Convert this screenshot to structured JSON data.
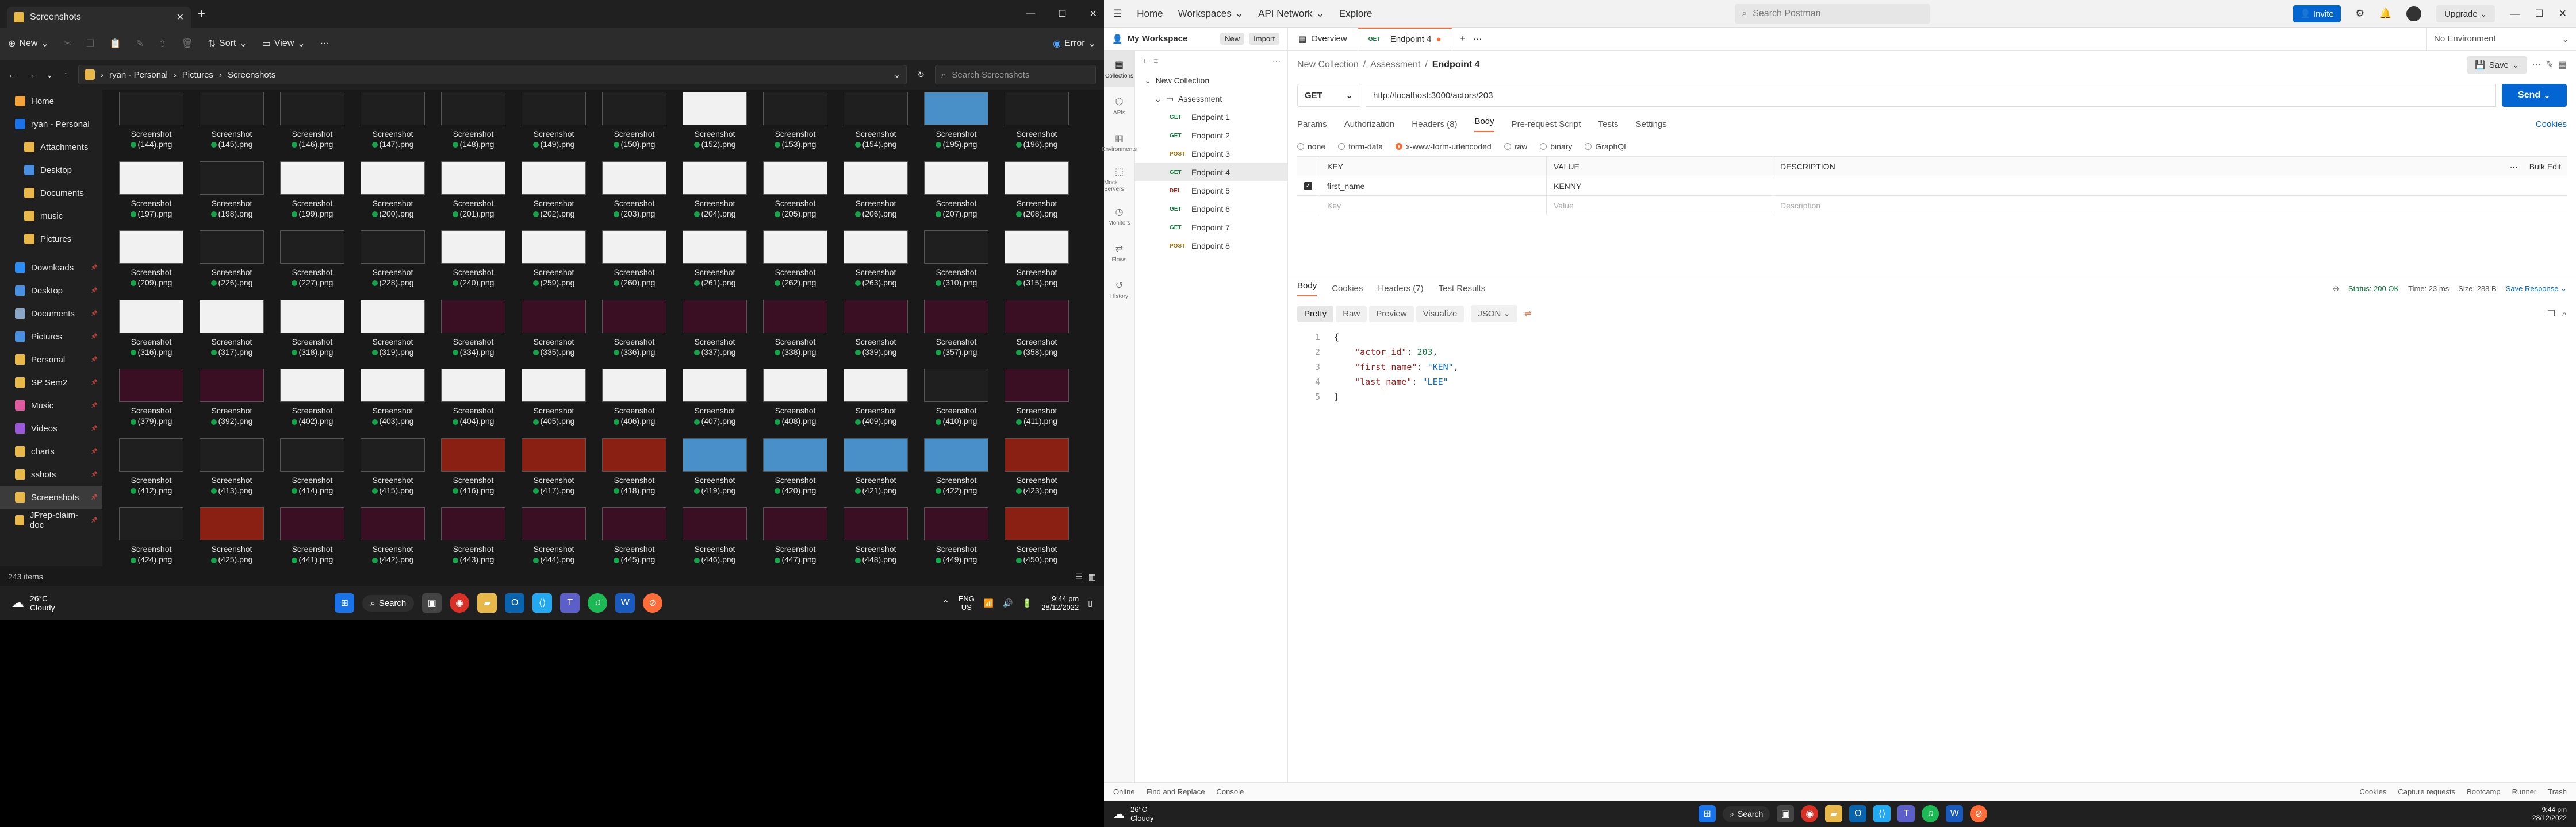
{
  "explorer": {
    "tab_title": "Screenshots",
    "toolbar": {
      "new_label": "New",
      "sort_label": "Sort",
      "view_label": "View",
      "filter_label": "Error"
    },
    "breadcrumb": [
      "ryan - Personal",
      "Pictures",
      "Screenshots"
    ],
    "search_placeholder": "Search Screenshots",
    "nav_top": [
      "Home",
      "ryan - Personal",
      "Attachments",
      "Desktop",
      "Documents",
      "music",
      "Pictures"
    ],
    "nav_quick": [
      "Downloads",
      "Desktop",
      "Documents",
      "Pictures",
      "Personal",
      "SP Sem2",
      "Music",
      "Videos",
      "charts",
      "sshots",
      "Screenshots",
      "JPrep-claim-doc"
    ],
    "status": "243 items",
    "file_label": "Screenshot",
    "files": [
      "(144).png",
      "(145).png",
      "(146).png",
      "(147).png",
      "(148).png",
      "(149).png",
      "(150).png",
      "(152).png",
      "(153).png",
      "(154).png",
      "(195).png",
      "(196).png",
      "(197).png",
      "(198).png",
      "(199).png",
      "(200).png",
      "(201).png",
      "(202).png",
      "(203).png",
      "(204).png",
      "(205).png",
      "(206).png",
      "(207).png",
      "(208).png",
      "(209).png",
      "(226).png",
      "(227).png",
      "(228).png",
      "(240).png",
      "(259).png",
      "(260).png",
      "(261).png",
      "(262).png",
      "(263).png",
      "(310).png",
      "(315).png",
      "(316).png",
      "(317).png",
      "(318).png",
      "(319).png",
      "(334).png",
      "(335).png",
      "(336).png",
      "(337).png",
      "(338).png",
      "(339).png",
      "(357).png",
      "(358).png",
      "(379).png",
      "(392).png",
      "(402).png",
      "(403).png",
      "(404).png",
      "(405).png",
      "(406).png",
      "(407).png",
      "(408).png",
      "(409).png",
      "(410).png",
      "(411).png",
      "(412).png",
      "(413).png",
      "(414).png",
      "(415).png",
      "(416).png",
      "(417).png",
      "(418).png",
      "(419).png",
      "(420).png",
      "(421).png",
      "(422).png",
      "(423).png",
      "(424).png",
      "(425).png",
      "(441).png",
      "(442).png",
      "(443).png",
      "(444).png",
      "(445).png",
      "(446).png",
      "(447).png",
      "(448).png",
      "(449).png",
      "(450).png"
    ],
    "thumb_colors": [
      "d",
      "d",
      "d",
      "d",
      "d",
      "d",
      "d",
      "w",
      "d",
      "d",
      "b",
      "d",
      "w",
      "d",
      "w",
      "w",
      "w",
      "w",
      "w",
      "w",
      "w",
      "w",
      "w",
      "w",
      "w",
      "d",
      "d",
      "d",
      "w",
      "w",
      "w",
      "w",
      "w",
      "w",
      "d",
      "w",
      "w",
      "w",
      "w",
      "w",
      "p",
      "p",
      "p",
      "p",
      "p",
      "p",
      "p",
      "p",
      "p",
      "p",
      "w",
      "w",
      "w",
      "w",
      "w",
      "w",
      "w",
      "w",
      "d",
      "p",
      "d",
      "d",
      "d",
      "d",
      "r",
      "r",
      "r",
      "b",
      "b",
      "b",
      "b",
      "r",
      "d",
      "r",
      "p",
      "p",
      "p",
      "p",
      "p",
      "p",
      "p",
      "p",
      "p",
      "r"
    ]
  },
  "taskbar_left": {
    "weather_temp": "26°C",
    "weather_desc": "Cloudy",
    "search_label": "Search",
    "lang": "ENG",
    "region": "US",
    "time": "9:44 pm",
    "date": "28/12/2022"
  },
  "postman": {
    "menu": [
      "Home",
      "Workspaces",
      "API Network",
      "Explore"
    ],
    "search_placeholder": "Search Postman",
    "invite_label": "Invite",
    "upgrade_label": "Upgrade",
    "workspace": "My Workspace",
    "new_label": "New",
    "import_label": "Import",
    "overview_tab": "Overview",
    "active_tab": "Endpoint 4",
    "environment": "No Environment",
    "rail": [
      "Collections",
      "APIs",
      "Environments",
      "Mock Servers",
      "Monitors",
      "Flows",
      "History"
    ],
    "tree_root": "New Collection",
    "tree_folder": "Assessment",
    "endpoints": [
      {
        "method": "GET",
        "name": "Endpoint 1"
      },
      {
        "method": "GET",
        "name": "Endpoint 2"
      },
      {
        "method": "POST",
        "name": "Endpoint 3"
      },
      {
        "method": "GET",
        "name": "Endpoint 4"
      },
      {
        "method": "DEL",
        "name": "Endpoint 5"
      },
      {
        "method": "GET",
        "name": "Endpoint 6"
      },
      {
        "method": "GET",
        "name": "Endpoint 7"
      },
      {
        "method": "POST",
        "name": "Endpoint 8"
      }
    ],
    "breadcrumb": [
      "New Collection",
      "Assessment",
      "Endpoint 4"
    ],
    "save_label": "Save",
    "method": "GET",
    "url": "http://localhost:3000/actors/203",
    "send_label": "Send",
    "req_tabs": [
      "Params",
      "Authorization",
      "Headers (8)",
      "Body",
      "Pre-request Script",
      "Tests",
      "Settings"
    ],
    "cookies_label": "Cookies",
    "body_modes": [
      "none",
      "form-data",
      "x-www-form-urlencoded",
      "raw",
      "binary",
      "GraphQL"
    ],
    "kv_headers": [
      "KEY",
      "VALUE",
      "DESCRIPTION"
    ],
    "bulk_edit": "Bulk Edit",
    "kv_rows": [
      {
        "key": "first_name",
        "value": "KENNY",
        "desc": ""
      }
    ],
    "kv_placeholder": {
      "key": "Key",
      "value": "Value",
      "desc": "Description"
    },
    "resp_tabs": [
      "Body",
      "Cookies",
      "Headers (7)",
      "Test Results"
    ],
    "status": "Status: 200 OK",
    "time": "Time: 23 ms",
    "size": "Size: 288 B",
    "save_response": "Save Response",
    "view_modes": [
      "Pretty",
      "Raw",
      "Preview",
      "Visualize"
    ],
    "format": "JSON",
    "response": {
      "actor_id": "203",
      "first_name": "\"KEN\"",
      "last_name": "\"LEE\""
    },
    "footer": [
      "Online",
      "Find and Replace",
      "Console",
      "Cookies",
      "Capture requests",
      "Bootcamp",
      "Runner",
      "Trash"
    ]
  },
  "taskbar_right": {
    "weather_temp": "26°C",
    "weather_desc": "Cloudy",
    "search_label": "Search",
    "time": "9:44 pm",
    "date": "28/12/2022"
  }
}
